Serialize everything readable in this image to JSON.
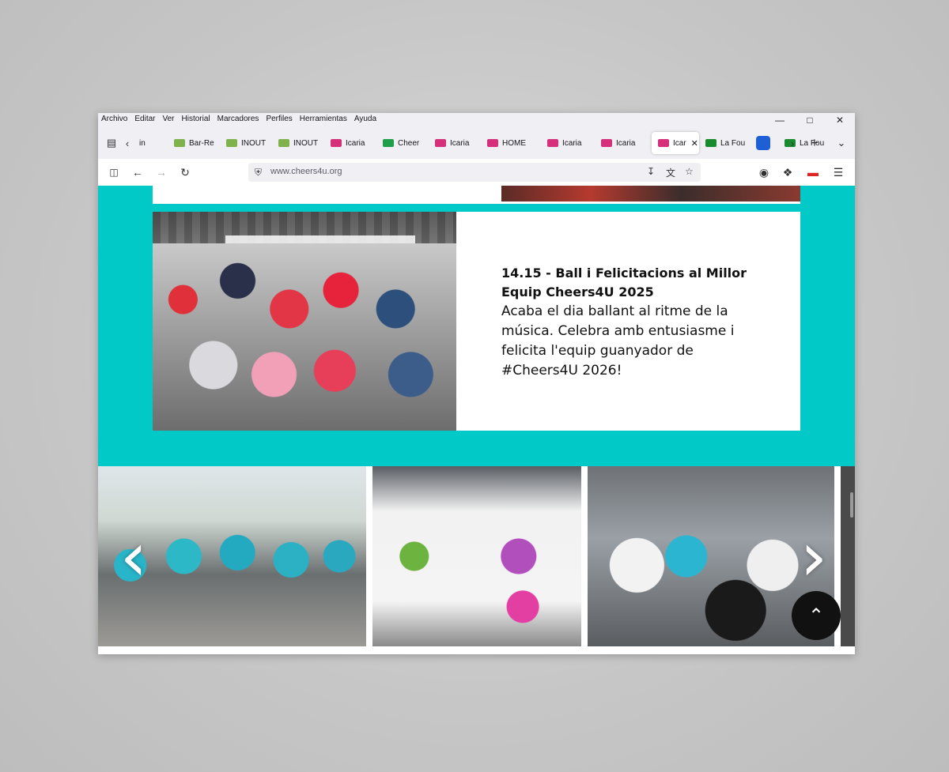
{
  "menu": [
    "Archivo",
    "Editar",
    "Ver",
    "Historial",
    "Marcadores",
    "Perfiles",
    "Herramientas",
    "Ayuda"
  ],
  "tabs": [
    {
      "label": "in",
      "fav": "#cccccc"
    },
    {
      "label": "Bar-Re",
      "fav": "#7fb24a"
    },
    {
      "label": "INOUT",
      "fav": "#7fb24a"
    },
    {
      "label": "INOUT",
      "fav": "#7fb24a"
    },
    {
      "label": "Icaria",
      "fav": "#d6307b"
    },
    {
      "label": "Cheer",
      "fav": "#1f9f4a"
    },
    {
      "label": "Icaria",
      "fav": "#d6307b"
    },
    {
      "label": "HOME",
      "fav": "#d6307b"
    },
    {
      "label": "Icaria",
      "fav": "#d6307b"
    },
    {
      "label": "Icaria",
      "fav": "#d6307b"
    },
    {
      "label": "Icar",
      "fav": "#d6307b",
      "active": true
    },
    {
      "label": "La Fou",
      "fav": "#1a8a2e"
    },
    {
      "label": "",
      "fav": "#1f5fd6"
    },
    {
      "label": "La Fou",
      "fav": "#1a8a2e"
    }
  ],
  "url": "www.cheers4u.org",
  "card": {
    "title": "14.15 - Ball i Felicitacions al Millor Equip Cheers4U 2025",
    "body": "Acaba el dia ballant al ritme de la música. Celebra amb entusiasme i felicita l'equip guanyador de #Cheers4U 2026!"
  },
  "colors": {
    "accent": "#00c9c8"
  },
  "icons": {
    "prev": "chevron-left-icon",
    "next": "chevron-right-icon",
    "totop": "chevron-up-icon"
  }
}
